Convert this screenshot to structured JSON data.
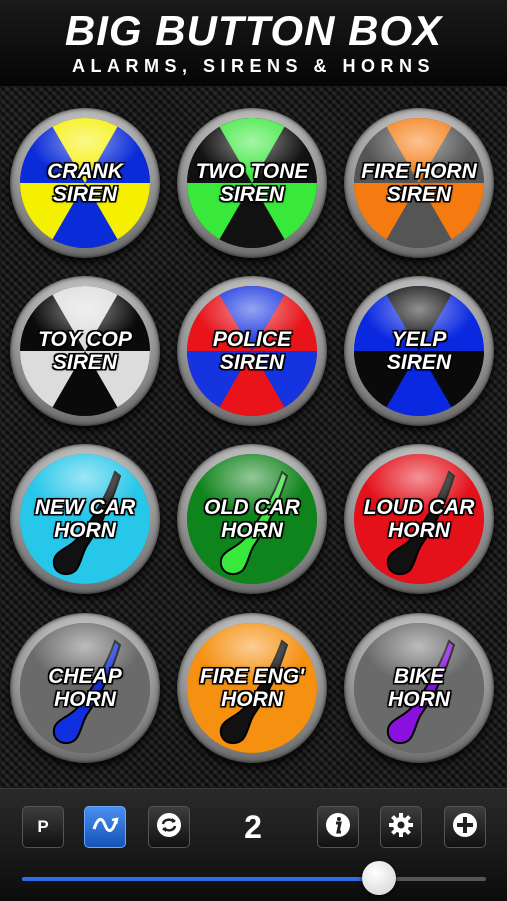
{
  "header": {
    "title": "BIG BUTTON BOX",
    "subtitle": "ALARMS, SIRENS & HORNS"
  },
  "buttons": [
    {
      "line1": "CRANK",
      "line2": "SIREN",
      "style": "radiation",
      "color1": "#0a2bd8",
      "color2": "#f5f000",
      "icon": "radiation-icon"
    },
    {
      "line1": "TWO TONE",
      "line2": "SIREN",
      "style": "radiation",
      "color1": "#111111",
      "color2": "#38e83a",
      "icon": "radiation-icon"
    },
    {
      "line1": "FIRE HORN",
      "line2": "SIREN",
      "style": "radiation",
      "color1": "#555555",
      "color2": "#f57a10",
      "icon": "radiation-icon"
    },
    {
      "line1": "TOY COP",
      "line2": "SIREN",
      "style": "radiation",
      "color1": "#0a0a0a",
      "color2": "#dcdcdc",
      "icon": "radiation-icon"
    },
    {
      "line1": "POLICE",
      "line2": "SIREN",
      "style": "radiation",
      "color1": "#e8141a",
      "color2": "#1534e0",
      "icon": "radiation-icon"
    },
    {
      "line1": "YELP",
      "line2": "SIREN",
      "style": "radiation",
      "color1": "#0a28e0",
      "color2": "#0a0a0a",
      "icon": "radiation-icon"
    },
    {
      "line1": "NEW CAR",
      "line2": "HORN",
      "style": "horn",
      "color1": "#27c7ea",
      "color2": "#111111",
      "icon": "horn-icon"
    },
    {
      "line1": "OLD CAR",
      "line2": "HORN",
      "style": "horn",
      "color1": "#10841c",
      "color2": "#38e83a",
      "icon": "horn-icon"
    },
    {
      "line1": "LOUD CAR",
      "line2": "HORN",
      "style": "horn",
      "color1": "#e4101a",
      "color2": "#111111",
      "icon": "horn-icon"
    },
    {
      "line1": "CHEAP",
      "line2": "HORN",
      "style": "horn",
      "color1": "#6a6a6a",
      "color2": "#1030e0",
      "icon": "horn-icon"
    },
    {
      "line1": "FIRE ENG'",
      "line2": "HORN",
      "style": "horn",
      "color1": "#f59010",
      "color2": "#111111",
      "icon": "horn-icon"
    },
    {
      "line1": "BIKE",
      "line2": "HORN",
      "style": "horn",
      "color1": "#6a6a6a",
      "color2": "#8a10e0",
      "icon": "horn-icon"
    }
  ],
  "toolbar": {
    "p_label": "P",
    "page_number": "2",
    "accent": "#2e6de8"
  },
  "volume": {
    "level": 0.77
  }
}
